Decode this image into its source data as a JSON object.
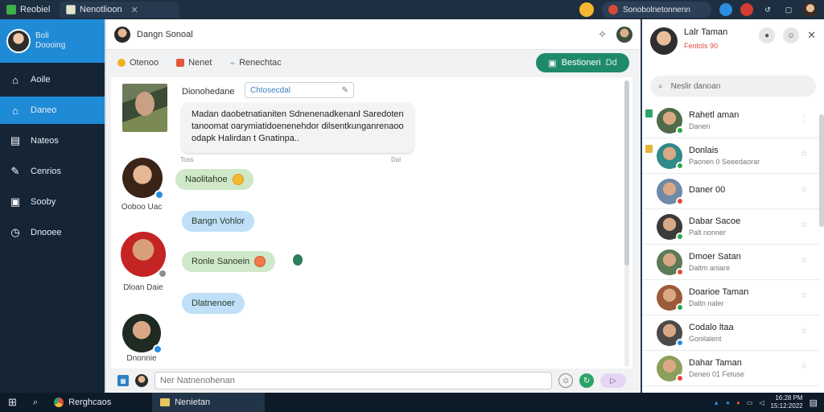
{
  "browser": {
    "tabs": [
      {
        "label": "Reobiel",
        "icon": "app-icon"
      },
      {
        "label": "Nenotlioon",
        "icon": "page-icon",
        "close": "✕"
      }
    ],
    "address_pill": "Sonobolnetonnenn"
  },
  "sidebar": {
    "profile_line1": "Boli",
    "profile_line2": "Doooing",
    "items": [
      {
        "label": "Aoile",
        "icon": "home-icon"
      },
      {
        "label": "Daneo",
        "icon": "home-icon",
        "active": true
      },
      {
        "label": "Nateos",
        "icon": "grid-icon"
      },
      {
        "label": "Cenrios",
        "icon": "wand-icon"
      },
      {
        "label": "Sooby",
        "icon": "briefcase-icon"
      },
      {
        "label": "Dnooee",
        "icon": "clock-icon"
      }
    ]
  },
  "chat": {
    "title": "Dangn Sonoal",
    "toolbar": [
      {
        "label": "Otenoo",
        "color": "#f2b01e"
      },
      {
        "label": "Nenet",
        "color": "#e2573b"
      },
      {
        "label": "Renechtac",
        "color": "#9aa3ab"
      }
    ],
    "green_button": "Bestioneri",
    "green_button_side": "Dd",
    "sender_name": "Dionohedane",
    "inline_input_value": "Chtosecdal",
    "big_message": "Madan daobetnatianiten Sdnenenadkenanl Saredoten tanoomat oarymiatidoenenehdor dilsentkunganrenaoo odapk Halirdan t Gnatinpa..",
    "meta_left": "Toss",
    "meta_right": "Dal",
    "messages": [
      {
        "text": "Naolitahoe",
        "style": "green"
      },
      {
        "text": "Bangn Vohlor",
        "style": "blue"
      },
      {
        "text": "Ronle Sanoein",
        "style": "green"
      },
      {
        "text": "Dlatnenoer",
        "style": "blue"
      }
    ],
    "user_names": [
      "Ooboo Uac",
      "Dloan Daie",
      "Dnonnie"
    ],
    "composer_placeholder": "Ner Natnenohenan"
  },
  "contacts_panel": {
    "title": "Lalr Taman",
    "subtitle": "Fentols 90",
    "search_placeholder": "Neslir danoan",
    "contacts": [
      {
        "name": "Rahetl aman",
        "status": "Danen",
        "online": "#2ba84a"
      },
      {
        "name": "Donlais",
        "status": "Paonen 0 Seeedaorar",
        "online": "#2ba84a"
      },
      {
        "name": "Daner 00",
        "status": "",
        "online": "#e14b3a"
      },
      {
        "name": "Dabar Sacoe",
        "status": "Palt nonner",
        "online": "#2ba84a"
      },
      {
        "name": "Dmoer Satan",
        "status": "Daltm aniare",
        "online": "#e14b3a"
      },
      {
        "name": "Doarioe Taman",
        "status": "Daltn naler",
        "online": "#2ba84a"
      },
      {
        "name": "Codalo ltaa",
        "status": "Gonilalent",
        "online": "#2b8ee0"
      },
      {
        "name": "Dahar Taman",
        "status": "Deneo 01 Fetuse",
        "online": "#e14b3a"
      }
    ]
  },
  "taskbar": {
    "items": [
      {
        "label": "Rerghcaos",
        "icon": "browser-icon"
      },
      {
        "label": "Nenietan",
        "icon": "folder-icon",
        "active": true
      }
    ],
    "time": "16:28 PM",
    "date": "15:12:2022"
  }
}
